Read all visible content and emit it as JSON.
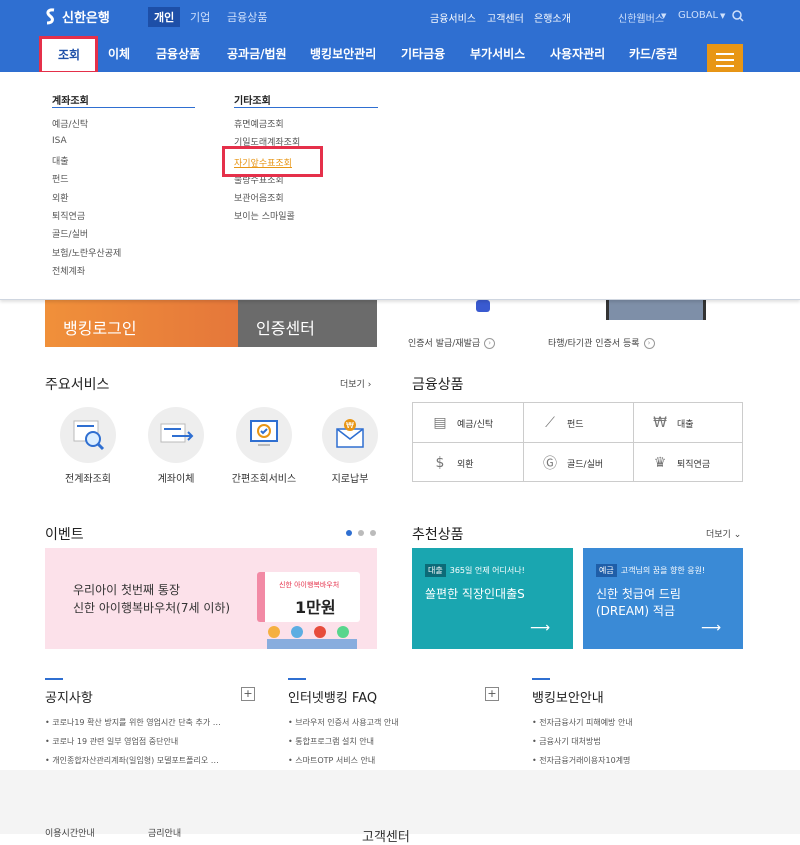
{
  "brand": {
    "name": "신한은행"
  },
  "segments": [
    {
      "label": "개인",
      "active": true
    },
    {
      "label": "기업"
    },
    {
      "label": "금융상품"
    }
  ],
  "utility": {
    "links": [
      "금융서비스",
      "고객센터",
      "은행소개"
    ],
    "family": "신한웹버스",
    "global": "GLOBAL"
  },
  "nav": {
    "items": [
      "조회",
      "이체",
      "금융상품",
      "공과금/법원",
      "뱅킹보안관리",
      "기타금융",
      "부가서비스",
      "사용자관리",
      "카드/증권"
    ]
  },
  "dropdown": {
    "col1": {
      "title": "계좌조회",
      "items": [
        "예금/신탁",
        "ISA",
        "대출",
        "펀드",
        "외환",
        "퇴직연금",
        "골드/실버",
        "보험/노란우산공제",
        "전체계좌"
      ]
    },
    "col2": {
      "title": "기타조회",
      "items": [
        "휴면예금조회",
        "기일도래계좌조회",
        "자기앞수표조회",
        "불량수표조회",
        "보관어음조회",
        "보이는 스마일콜"
      ]
    }
  },
  "login": {
    "label": "뱅킹로그인"
  },
  "cert": {
    "label": "인증센터"
  },
  "cert_links": [
    "인증서 발급/재발급",
    "타행/타기관 인증서 등록"
  ],
  "main_services": {
    "title": "주요서비스",
    "more": "더보기",
    "items": [
      "전계좌조회",
      "계좌이체",
      "간편조회서비스",
      "지로납부"
    ]
  },
  "products": {
    "title": "금융상품",
    "items": [
      "예금/신탁",
      "펀드",
      "대출",
      "외환",
      "골드/실버",
      "퇴직연금"
    ]
  },
  "event": {
    "title": "이벤트",
    "line1": "우리아이 첫번째 통장",
    "line2": "신한 아이행복바우처(7세 이하)",
    "card_small": "신한 아이행복바우처",
    "card_big": "1만원"
  },
  "recommend": {
    "title": "추천상품",
    "more": "더보기",
    "cards": [
      {
        "tag": "대출",
        "sub": "365일 언제 어디서나!",
        "title": "쏠편한 직장인대출S"
      },
      {
        "tag": "예금",
        "sub": "고객님의 꿈을 향한 응원!",
        "title1": "신한 첫급여 드림",
        "title2": "(DREAM) 적금"
      }
    ]
  },
  "notice": {
    "title": "공지사항",
    "items": [
      "코로나19 확산 방지를 위한 영업시간 단축 추가 …",
      "코로나 19 관련 일부 영업점 중단안내",
      "개인종합자산관리계좌(일임형) 모델포트폴리오 …"
    ]
  },
  "faq": {
    "title": "인터넷뱅킹 FAQ",
    "items": [
      "브라우저 인증서 사용고객 안내",
      "통합프로그램 설치 안내",
      "스마트OTP 서비스 안내"
    ]
  },
  "security": {
    "title": "뱅킹보안안내",
    "items": [
      "전자금융사기 피해예방 안내",
      "금융사기 대처방법",
      "전자금융거래이용자10계명"
    ]
  },
  "footer": {
    "items": [
      "이용시간안내",
      "금리안내",
      "고객센터"
    ]
  },
  "colors": {
    "primary": "#2f6fd1",
    "accent": "#e89616",
    "highlight": "#e5304a"
  }
}
